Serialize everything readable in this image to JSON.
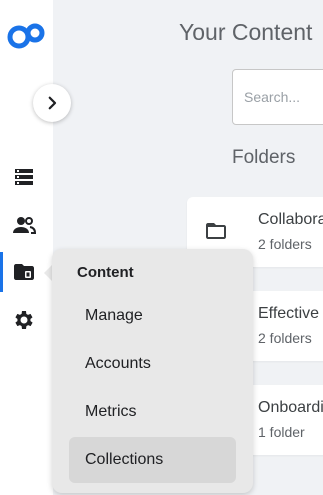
{
  "header": {
    "title": "Your Content"
  },
  "search": {
    "placeholder": "Search..."
  },
  "folders": {
    "section_title": "Folders",
    "items": [
      {
        "title": "Collabora",
        "subtitle": "2 folders"
      },
      {
        "title": "Effective",
        "subtitle": "2 folders"
      },
      {
        "title": "Onboardi",
        "subtitle": "1 folder"
      }
    ]
  },
  "sidebar": {
    "icons": [
      "logo-icon",
      "list-icon",
      "people-icon",
      "folder-icon",
      "gear-icon"
    ],
    "active": "folder-icon"
  },
  "flyout": {
    "title": "Content",
    "items": [
      {
        "label": "Manage"
      },
      {
        "label": "Accounts"
      },
      {
        "label": "Metrics"
      },
      {
        "label": "Collections",
        "selected": true
      }
    ]
  },
  "colors": {
    "accent": "#1a73e8",
    "icon": "#202124",
    "background": "#f0f2f5",
    "flyout_bg": "#e8e8e8",
    "flyout_selected": "#d7d7d7"
  }
}
